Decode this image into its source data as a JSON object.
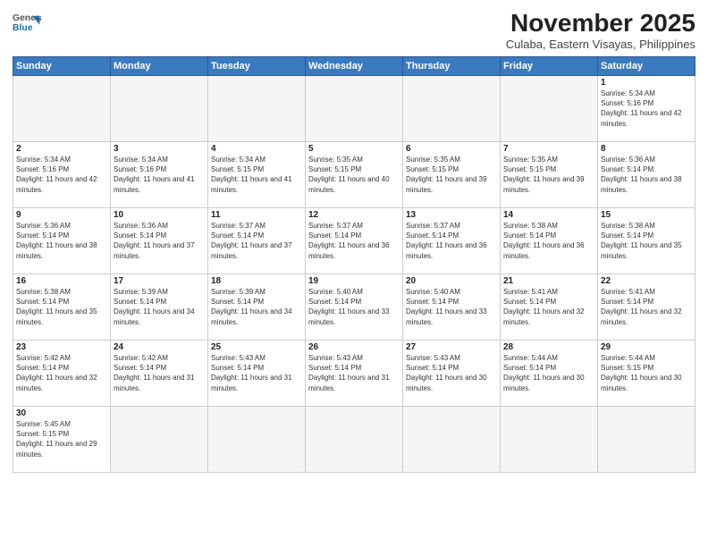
{
  "header": {
    "logo_line1": "General",
    "logo_line2": "Blue",
    "title": "November 2025",
    "subtitle": "Culaba, Eastern Visayas, Philippines"
  },
  "weekdays": [
    "Sunday",
    "Monday",
    "Tuesday",
    "Wednesday",
    "Thursday",
    "Friday",
    "Saturday"
  ],
  "days": [
    {
      "num": "",
      "sunrise": "",
      "sunset": "",
      "daylight": "",
      "empty": true
    },
    {
      "num": "",
      "sunrise": "",
      "sunset": "",
      "daylight": "",
      "empty": true
    },
    {
      "num": "",
      "sunrise": "",
      "sunset": "",
      "daylight": "",
      "empty": true
    },
    {
      "num": "",
      "sunrise": "",
      "sunset": "",
      "daylight": "",
      "empty": true
    },
    {
      "num": "",
      "sunrise": "",
      "sunset": "",
      "daylight": "",
      "empty": true
    },
    {
      "num": "",
      "sunrise": "",
      "sunset": "",
      "daylight": "",
      "empty": true
    },
    {
      "num": "1",
      "sunrise": "Sunrise: 5:34 AM",
      "sunset": "Sunset: 5:16 PM",
      "daylight": "Daylight: 11 hours and 42 minutes."
    },
    {
      "num": "2",
      "sunrise": "Sunrise: 5:34 AM",
      "sunset": "Sunset: 5:16 PM",
      "daylight": "Daylight: 11 hours and 42 minutes."
    },
    {
      "num": "3",
      "sunrise": "Sunrise: 5:34 AM",
      "sunset": "Sunset: 5:16 PM",
      "daylight": "Daylight: 11 hours and 41 minutes."
    },
    {
      "num": "4",
      "sunrise": "Sunrise: 5:34 AM",
      "sunset": "Sunset: 5:15 PM",
      "daylight": "Daylight: 11 hours and 41 minutes."
    },
    {
      "num": "5",
      "sunrise": "Sunrise: 5:35 AM",
      "sunset": "Sunset: 5:15 PM",
      "daylight": "Daylight: 11 hours and 40 minutes."
    },
    {
      "num": "6",
      "sunrise": "Sunrise: 5:35 AM",
      "sunset": "Sunset: 5:15 PM",
      "daylight": "Daylight: 11 hours and 39 minutes."
    },
    {
      "num": "7",
      "sunrise": "Sunrise: 5:35 AM",
      "sunset": "Sunset: 5:15 PM",
      "daylight": "Daylight: 11 hours and 39 minutes."
    },
    {
      "num": "8",
      "sunrise": "Sunrise: 5:36 AM",
      "sunset": "Sunset: 5:14 PM",
      "daylight": "Daylight: 11 hours and 38 minutes."
    },
    {
      "num": "9",
      "sunrise": "Sunrise: 5:36 AM",
      "sunset": "Sunset: 5:14 PM",
      "daylight": "Daylight: 11 hours and 38 minutes."
    },
    {
      "num": "10",
      "sunrise": "Sunrise: 5:36 AM",
      "sunset": "Sunset: 5:14 PM",
      "daylight": "Daylight: 11 hours and 37 minutes."
    },
    {
      "num": "11",
      "sunrise": "Sunrise: 5:37 AM",
      "sunset": "Sunset: 5:14 PM",
      "daylight": "Daylight: 11 hours and 37 minutes."
    },
    {
      "num": "12",
      "sunrise": "Sunrise: 5:37 AM",
      "sunset": "Sunset: 5:14 PM",
      "daylight": "Daylight: 11 hours and 36 minutes."
    },
    {
      "num": "13",
      "sunrise": "Sunrise: 5:37 AM",
      "sunset": "Sunset: 5:14 PM",
      "daylight": "Daylight: 11 hours and 36 minutes."
    },
    {
      "num": "14",
      "sunrise": "Sunrise: 5:38 AM",
      "sunset": "Sunset: 5:14 PM",
      "daylight": "Daylight: 11 hours and 36 minutes."
    },
    {
      "num": "15",
      "sunrise": "Sunrise: 5:38 AM",
      "sunset": "Sunset: 5:14 PM",
      "daylight": "Daylight: 11 hours and 35 minutes."
    },
    {
      "num": "16",
      "sunrise": "Sunrise: 5:38 AM",
      "sunset": "Sunset: 5:14 PM",
      "daylight": "Daylight: 11 hours and 35 minutes."
    },
    {
      "num": "17",
      "sunrise": "Sunrise: 5:39 AM",
      "sunset": "Sunset: 5:14 PM",
      "daylight": "Daylight: 11 hours and 34 minutes."
    },
    {
      "num": "18",
      "sunrise": "Sunrise: 5:39 AM",
      "sunset": "Sunset: 5:14 PM",
      "daylight": "Daylight: 11 hours and 34 minutes."
    },
    {
      "num": "19",
      "sunrise": "Sunrise: 5:40 AM",
      "sunset": "Sunset: 5:14 PM",
      "daylight": "Daylight: 11 hours and 33 minutes."
    },
    {
      "num": "20",
      "sunrise": "Sunrise: 5:40 AM",
      "sunset": "Sunset: 5:14 PM",
      "daylight": "Daylight: 11 hours and 33 minutes."
    },
    {
      "num": "21",
      "sunrise": "Sunrise: 5:41 AM",
      "sunset": "Sunset: 5:14 PM",
      "daylight": "Daylight: 11 hours and 32 minutes."
    },
    {
      "num": "22",
      "sunrise": "Sunrise: 5:41 AM",
      "sunset": "Sunset: 5:14 PM",
      "daylight": "Daylight: 11 hours and 32 minutes."
    },
    {
      "num": "23",
      "sunrise": "Sunrise: 5:42 AM",
      "sunset": "Sunset: 5:14 PM",
      "daylight": "Daylight: 11 hours and 32 minutes."
    },
    {
      "num": "24",
      "sunrise": "Sunrise: 5:42 AM",
      "sunset": "Sunset: 5:14 PM",
      "daylight": "Daylight: 11 hours and 31 minutes."
    },
    {
      "num": "25",
      "sunrise": "Sunrise: 5:43 AM",
      "sunset": "Sunset: 5:14 PM",
      "daylight": "Daylight: 11 hours and 31 minutes."
    },
    {
      "num": "26",
      "sunrise": "Sunrise: 5:43 AM",
      "sunset": "Sunset: 5:14 PM",
      "daylight": "Daylight: 11 hours and 31 minutes."
    },
    {
      "num": "27",
      "sunrise": "Sunrise: 5:43 AM",
      "sunset": "Sunset: 5:14 PM",
      "daylight": "Daylight: 11 hours and 30 minutes."
    },
    {
      "num": "28",
      "sunrise": "Sunrise: 5:44 AM",
      "sunset": "Sunset: 5:14 PM",
      "daylight": "Daylight: 11 hours and 30 minutes."
    },
    {
      "num": "29",
      "sunrise": "Sunrise: 5:44 AM",
      "sunset": "Sunset: 5:15 PM",
      "daylight": "Daylight: 11 hours and 30 minutes."
    },
    {
      "num": "30",
      "sunrise": "Sunrise: 5:45 AM",
      "sunset": "Sunset: 5:15 PM",
      "daylight": "Daylight: 11 hours and 29 minutes."
    }
  ]
}
